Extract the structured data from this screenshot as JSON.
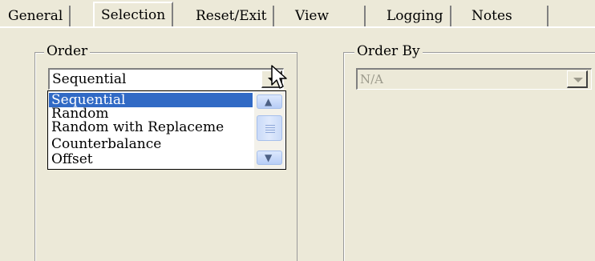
{
  "tabs": [
    {
      "label": "General"
    },
    {
      "label": "Selection",
      "active": true
    },
    {
      "label": "Reset/Exit"
    },
    {
      "label": "View"
    },
    {
      "label": "Logging"
    },
    {
      "label": "Notes"
    }
  ],
  "order_group": {
    "title": "Order",
    "combo_value": "Sequential",
    "options": [
      "Sequential",
      "Random",
      "Random with Replaceme",
      "Counterbalance",
      "Offset"
    ],
    "selected_index": 0
  },
  "order_by_group": {
    "title": "Order By",
    "combo_value": "N/A",
    "disabled": true
  },
  "icons": {
    "dropdown_arrow": "chevron-down-icon",
    "scroll_up": "scroll-up-icon",
    "scroll_down": "scroll-down-icon",
    "cursor": "mouse-pointer-icon"
  },
  "colors": {
    "background": "#ece9d8",
    "selection": "#316ac5"
  }
}
